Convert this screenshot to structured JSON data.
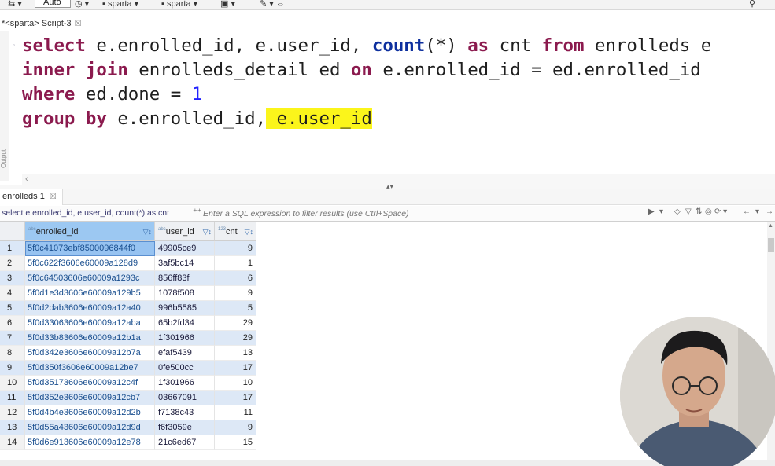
{
  "toolbar": {
    "auto_label": "Auto",
    "connection_1": "sparta",
    "connection_2": "sparta"
  },
  "editor_tab": {
    "label": "*<sparta> Script-3",
    "close": "☒"
  },
  "gutter_label": "Output",
  "sql": {
    "line1": {
      "kw1": "select",
      "t1": " e.enrolled_id, e.user_id, ",
      "fn1": "count",
      "t2": "(*) ",
      "kw2": "as",
      "t3": " cnt ",
      "kw3": "from",
      "t4": " enrolleds e"
    },
    "line2": {
      "kw1": "inner join",
      "t1": " enrolleds_detail ed ",
      "kw2": "on",
      "t2": " e.enrolled_id = ed.enrolled_id"
    },
    "line3": {
      "kw1": "where",
      "t1": " ed.done = ",
      "num1": "1"
    },
    "line4": {
      "kw1": "group by",
      "t1": " e.enrolled_id,",
      "hl": " e.user_id"
    }
  },
  "results": {
    "tab_label": "enrolleds 1",
    "tab_close": "☒",
    "query_echo": "select e.enrolled_id, e.user_id, count(*) as cnt",
    "filter_placeholder": "Enter a SQL expression to filter results (use Ctrl+Space)",
    "columns": [
      {
        "label": "enrolled_id",
        "type_badge": "abc"
      },
      {
        "label": "user_id",
        "type_badge": "abc"
      },
      {
        "label": "cnt",
        "type_badge": "123"
      }
    ],
    "rows": [
      {
        "n": "1",
        "enrolled_id": "5f0c41073ebf8500096844f0",
        "user_id": "49905ce9",
        "cnt": "9"
      },
      {
        "n": "2",
        "enrolled_id": "5f0c622f3606e60009a128d9",
        "user_id": "3af5bc14",
        "cnt": "1"
      },
      {
        "n": "3",
        "enrolled_id": "5f0c64503606e60009a1293c",
        "user_id": "856ff83f",
        "cnt": "6"
      },
      {
        "n": "4",
        "enrolled_id": "5f0d1e3d3606e60009a129b5",
        "user_id": "1078f508",
        "cnt": "9"
      },
      {
        "n": "5",
        "enrolled_id": "5f0d2dab3606e60009a12a40",
        "user_id": "996b5585",
        "cnt": "5"
      },
      {
        "n": "6",
        "enrolled_id": "5f0d33063606e60009a12aba",
        "user_id": "65b2fd34",
        "cnt": "29"
      },
      {
        "n": "7",
        "enrolled_id": "5f0d33b83606e60009a12b1a",
        "user_id": "1f301966",
        "cnt": "29"
      },
      {
        "n": "8",
        "enrolled_id": "5f0d342e3606e60009a12b7a",
        "user_id": "efaf5439",
        "cnt": "13"
      },
      {
        "n": "9",
        "enrolled_id": "5f0d350f3606e60009a12be7",
        "user_id": "0fe500cc",
        "cnt": "17"
      },
      {
        "n": "10",
        "enrolled_id": "5f0d35173606e60009a12c4f",
        "user_id": "1f301966",
        "cnt": "10"
      },
      {
        "n": "11",
        "enrolled_id": "5f0d352e3606e60009a12cb7",
        "user_id": "03667091",
        "cnt": "17"
      },
      {
        "n": "12",
        "enrolled_id": "5f0d4b4e3606e60009a12d2b",
        "user_id": "f7138c43",
        "cnt": "11"
      },
      {
        "n": "13",
        "enrolled_id": "5f0d55a43606e60009a12d9d",
        "user_id": "f6f3059e",
        "cnt": "9"
      },
      {
        "n": "14",
        "enrolled_id": "5f0d6e913606e60009a12e78",
        "user_id": "21c6ed67",
        "cnt": "15"
      }
    ]
  },
  "colors": {
    "keyword": "#8b1a4e",
    "function": "#0d2f9e",
    "number": "#2222ff",
    "highlight": "#fbf51b",
    "selected_header": "#9cc8f2"
  },
  "icons": [
    "search-icon",
    "filter-icon",
    "sort-icon",
    "close-icon",
    "chevron-down-icon",
    "scroll-left-icon"
  ]
}
